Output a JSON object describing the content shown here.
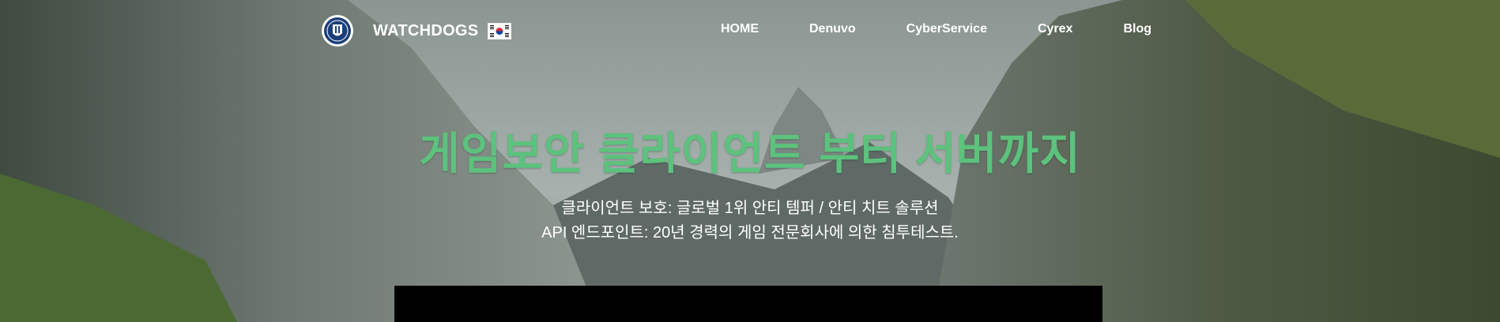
{
  "brand": {
    "name": "WATCHDOGS",
    "logo_icon": "shield-crest-icon",
    "flag_icon": "korea-flag-icon"
  },
  "nav": {
    "items": [
      "HOME",
      "Denuvo",
      "CyberService",
      "Cyrex",
      "Blog"
    ]
  },
  "hero": {
    "headline": "게임보안 클라이언트 부터 서버까지",
    "line1": "클라이언트 보호: 글로벌 1위 안티 템퍼 / 안티 치트 솔루션",
    "line2": "API 엔드포인트: 20년 경력의 게임 전문회사에 의한 침투테스트."
  },
  "colors": {
    "headline": "#5cc27d",
    "nav_text": "#ffffff",
    "panel": "#000000"
  }
}
